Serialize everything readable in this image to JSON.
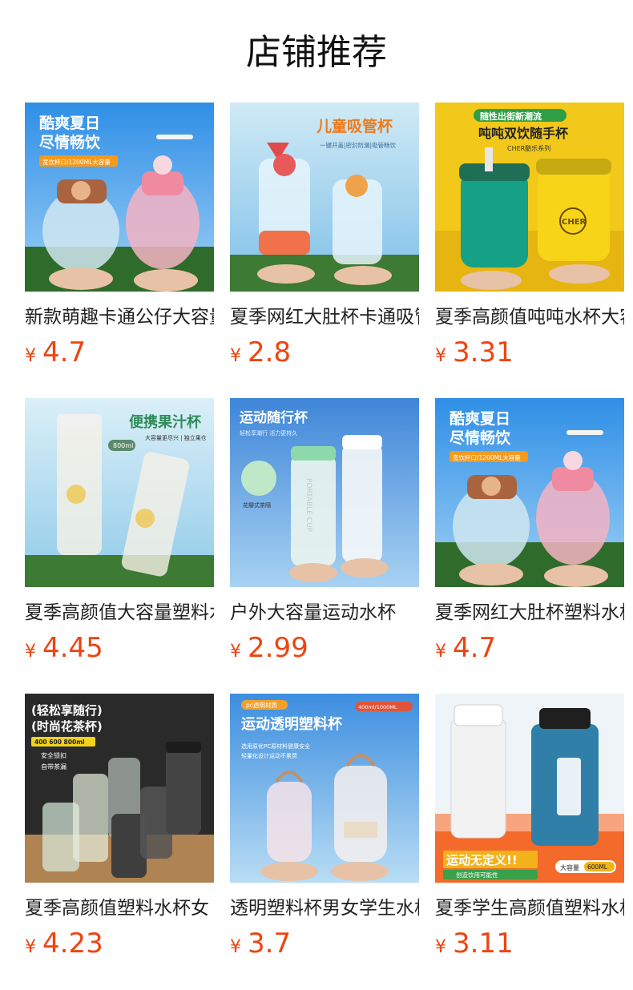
{
  "header": {
    "title": "店铺推荐"
  },
  "currency_symbol": "¥",
  "price_color": "#ee4411",
  "products": [
    {
      "name": "新款萌趣卡通公仔大容量塑料杯",
      "price": "4.7",
      "image_text": [
        "酷爽夏日",
        "尽情畅饮",
        "宽饮杯口/1200ML大容量"
      ],
      "image_icon": "water-bottle-icon"
    },
    {
      "name": "夏季网红大肚杯卡通吸管杯",
      "price": "2.8",
      "image_text": [
        "儿童吸管杯",
        "一键开盖|密封防漏|吸管畅饮"
      ],
      "image_icon": "water-bottle-icon"
    },
    {
      "name": "夏季高颜值吨吨水杯大容量",
      "price": "3.31",
      "image_text": [
        "随性出街新潮流",
        "吨吨双饮随手杯",
        "CHER酷乐系列",
        "CHER"
      ],
      "image_icon": "water-bottle-icon"
    },
    {
      "name": "夏季高颜值大容量塑料水杯",
      "price": "4.45",
      "image_text": [
        "便携果汁杯",
        "大容量更尽兴 | 独立果仓",
        "800ml"
      ],
      "image_icon": "water-bottle-icon"
    },
    {
      "name": "户外大容量运动水杯",
      "price": "2.99",
      "image_text": [
        "运动随行杯",
        "轻松享潮行 活力更持久",
        "花瓣式茶隔",
        "PORTABLE CUP"
      ],
      "image_icon": "water-bottle-icon"
    },
    {
      "name": "夏季网红大肚杯塑料水杯",
      "price": "4.7",
      "image_text": [
        "酷爽夏日",
        "尽情畅饮",
        "宽饮杯口/1200ML大容量"
      ],
      "image_icon": "water-bottle-icon"
    },
    {
      "name": "夏季高颜值塑料水杯女",
      "price": "4.23",
      "image_text": [
        "(轻松享随行)",
        "(时尚花茶杯)",
        "400 600 800ml",
        "安全锁扣",
        "自带茶漏"
      ],
      "image_icon": "water-bottle-icon"
    },
    {
      "name": "透明塑料杯男女学生水杯",
      "price": "3.7",
      "image_text": [
        "pc透明材质",
        "运动透明塑料杯",
        "400ml/1000ML",
        "选用原优PC原材料健康安全",
        "轻量化设计运动不累赘"
      ],
      "image_icon": "water-bottle-icon"
    },
    {
      "name": "夏季学生高颜值塑料水杯",
      "price": "3.11",
      "image_text": [
        "运动无定义!!",
        "创造饮用可能性",
        "大容量",
        "600ML"
      ],
      "image_icon": "water-bottle-icon"
    }
  ]
}
